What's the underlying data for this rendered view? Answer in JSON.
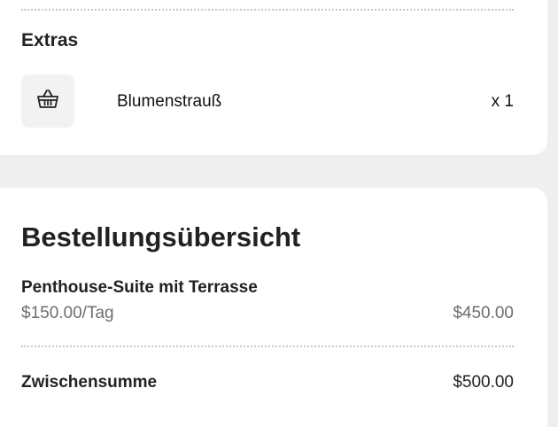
{
  "extras": {
    "title": "Extras",
    "items": [
      {
        "icon": "basket-icon",
        "name": "Blumenstrauß",
        "quantity": "x 1"
      }
    ]
  },
  "summary": {
    "title": "Bestellungsübersicht",
    "items": [
      {
        "name": "Penthouse-Suite mit Terrasse",
        "rate": "$150.00/Tag",
        "total": "$450.00"
      }
    ],
    "subtotal_label": "Zwischensumme",
    "subtotal_value": "$500.00"
  },
  "colors": {
    "page_background": "#efefef",
    "card_background": "#ffffff",
    "icon_box_background": "#f2f2f2",
    "muted_text": "#6e6e6e",
    "primary_text": "#222222"
  }
}
